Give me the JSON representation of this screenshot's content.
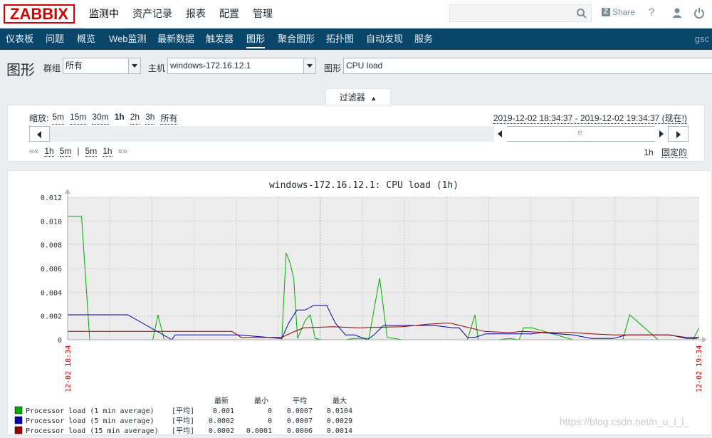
{
  "logo": "ZABBIX",
  "top_menu": [
    "监测中",
    "资产记录",
    "报表",
    "配置",
    "管理"
  ],
  "header": {
    "share_label": "Share",
    "help_glyph": "?",
    "user_icon": "user-icon",
    "power_icon": "power-icon",
    "search_icon": "search-icon"
  },
  "sub_menu": [
    "仪表板",
    "问题",
    "概览",
    "Web监测",
    "最新数据",
    "触发器",
    "图形",
    "聚合图形",
    "拓扑图",
    "自动发现",
    "服务"
  ],
  "sub_menu_active": "图形",
  "sub_user": "gsc",
  "page": {
    "title": "图形",
    "group_label": "群组",
    "group_value": "所有",
    "host_label": "主机",
    "host_value": "windows-172.16.12.1",
    "graph_label": "图形",
    "graph_value": "CPU load"
  },
  "filter": {
    "tab_label": "过滤器",
    "tab_arrow": "▲",
    "zoom_label": "缩放:",
    "zoom_options": [
      "5m",
      "15m",
      "30m",
      "1h",
      "2h",
      "3h",
      "所有"
    ],
    "zoom_active": "1h",
    "period_range": "2019-12-02 18:34:37 - 2019-12-02 19:34:37 (现在!)",
    "nav_back": "««",
    "nav_items": [
      "1h",
      "5m",
      "|",
      "5m",
      "1h"
    ],
    "nav_forward": "»»",
    "duration": "1h",
    "fixed_label": "固定的",
    "grip": "⁝⁝⁝"
  },
  "chart_data": {
    "type": "line",
    "title": "windows-172.16.12.1: CPU load (1h)",
    "ylim": [
      0,
      0.012
    ],
    "yticks": [
      "0.012",
      "0.010",
      "0.008",
      "0.006",
      "0.004",
      "0.002",
      "0"
    ],
    "x_start_label": "12-02 18:34",
    "x_end_label": "12-02 19:34",
    "grid": true,
    "legend_headers": [
      "最新",
      "最小",
      "平均",
      "最大"
    ],
    "series": [
      {
        "name": "Processor load (1 min average)",
        "color": "#00aa00",
        "stat": "[平均]",
        "latest": "0.001",
        "min": "0",
        "avg": "0.0007",
        "max": "0.0104",
        "x": [
          0,
          2.2,
          3.5,
          4.3,
          5.0,
          10,
          13.5,
          14.3,
          15.3,
          16.2,
          20,
          25,
          30,
          33.9,
          34.6,
          35.2,
          35.8,
          36.4,
          37.6,
          38.4,
          39.2,
          40.2,
          41.8,
          44,
          45.4,
          47.7,
          49.4,
          50.6,
          53,
          56,
          60,
          63.3,
          64.5,
          65,
          66.2,
          68.2,
          70,
          71.5,
          72.2,
          73.5,
          80,
          85,
          86.5,
          87.9,
          89,
          93.5,
          95,
          99,
          100
        ],
        "values": [
          0.0104,
          0.0104,
          0,
          0,
          0,
          0,
          0,
          0.0021,
          0,
          0,
          0,
          0,
          0,
          0,
          0.0073,
          0.0065,
          0.0052,
          0.0001,
          0.0016,
          0.0021,
          0.0001,
          0,
          0,
          0,
          0.0001,
          0.0001,
          0.0052,
          0.0002,
          0,
          0,
          0,
          0,
          0.0021,
          0,
          0,
          0,
          0.0001,
          0,
          0.001,
          0.001,
          0,
          0,
          0,
          0,
          0.0021,
          0,
          0,
          0,
          0.001
        ]
      },
      {
        "name": "Processor load (5 min average)",
        "color": "#0000aa",
        "stat": "[平均]",
        "latest": "0.0002",
        "min": "0",
        "avg": "0.0007",
        "max": "0.0029",
        "x": [
          0,
          8,
          9.5,
          16.5,
          17,
          26,
          27,
          33.9,
          35.0,
          36.3,
          37.6,
          39.0,
          41.0,
          42.4,
          44,
          45.4,
          47.5,
          48.5,
          50,
          56,
          58,
          61,
          62,
          63.3,
          64.5,
          66.2,
          69.2,
          70.6,
          72,
          73.5,
          75,
          80,
          83,
          86.4,
          88.5,
          93.5,
          95.4,
          98,
          99.5,
          100
        ],
        "values": [
          0.0021,
          0.0021,
          0.0021,
          0,
          0.0004,
          0.0004,
          0.0004,
          0.0001,
          0.0014,
          0.0025,
          0.0025,
          0.0029,
          0.0029,
          0.0014,
          0.0004,
          0.0004,
          0,
          0.0004,
          0.0012,
          0.0012,
          0.0012,
          0.001,
          0.001,
          0.0002,
          0.0002,
          0.0005,
          0.0005,
          0.0005,
          0.0005,
          0.0005,
          0.0006,
          0.0004,
          0.0001,
          0.0001,
          0.0004,
          0.0004,
          0.0004,
          0.0001,
          0.0001,
          0.0002
        ]
      },
      {
        "name": "Processor load (15 min average)",
        "color": "#990000",
        "stat": "[平均]",
        "latest": "0.0002",
        "min": "0.0001",
        "avg": "0.0006",
        "max": "0.0014",
        "x": [
          0,
          10,
          20,
          25,
          26,
          27.5,
          33.9,
          35.5,
          37.4,
          42,
          46,
          53,
          57,
          59.6,
          60.6,
          66,
          70,
          72,
          76,
          80,
          83,
          86.4,
          88,
          95,
          96.5,
          98,
          100
        ],
        "values": [
          0.0007,
          0.0007,
          0.0007,
          0.0007,
          0.0007,
          0.0002,
          0.0002,
          0.0006,
          0.001,
          0.0011,
          0.001,
          0.0011,
          0.0013,
          0.0014,
          0.0014,
          0.0007,
          0.0006,
          0.0007,
          0.0006,
          0.0006,
          0.0005,
          0.0004,
          0.0004,
          0.0004,
          0.0003,
          0.0002,
          0.0002
        ]
      }
    ]
  },
  "watermark": "https://blog.csdn.net/n_u_l_l_"
}
